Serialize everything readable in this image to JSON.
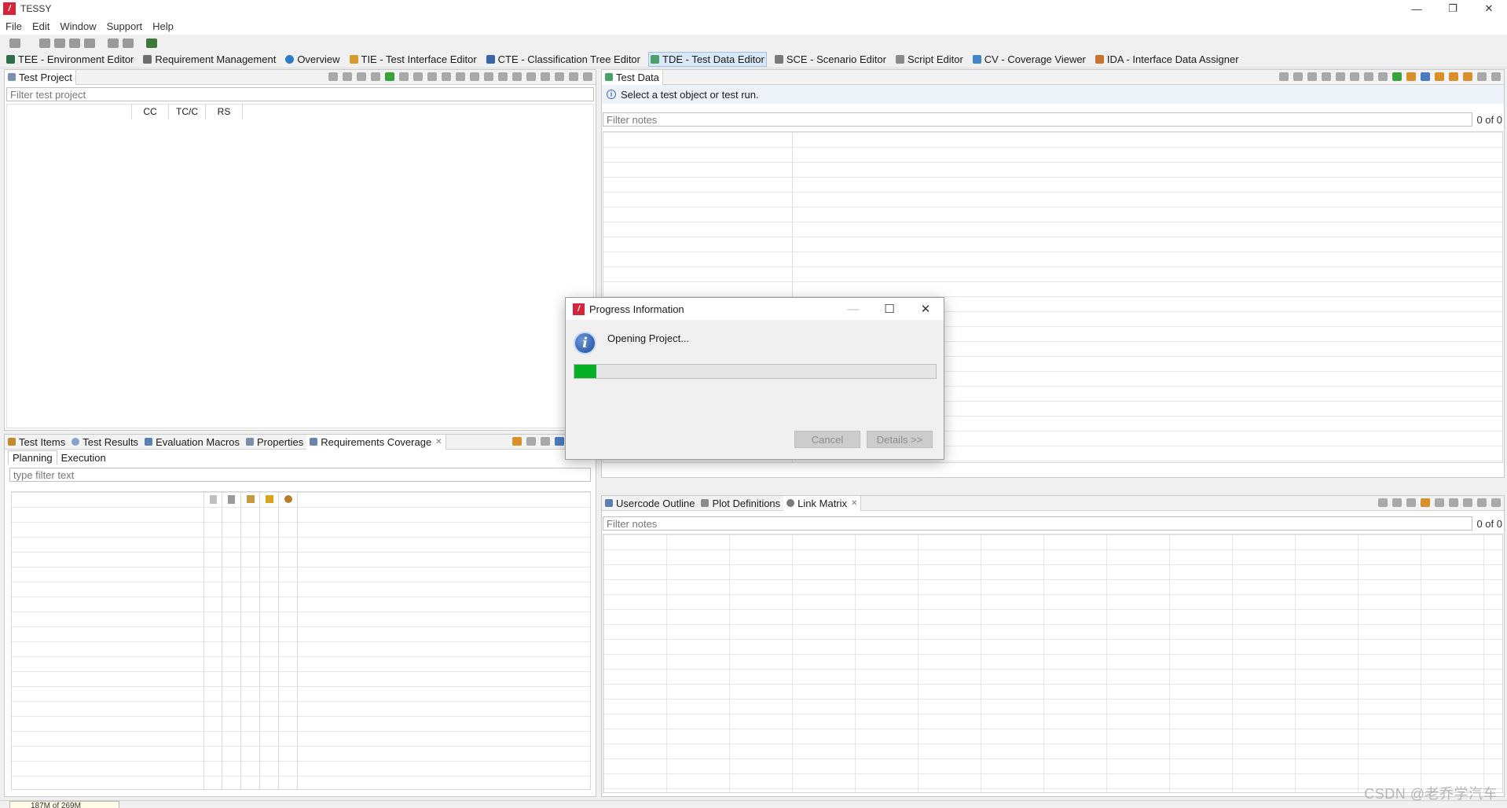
{
  "window": {
    "title": "TESSY",
    "controls": [
      "—",
      "❐",
      "✕"
    ]
  },
  "menu": [
    "File",
    "Edit",
    "Window",
    "Support",
    "Help"
  ],
  "perspectives": [
    {
      "label": "TEE - Environment Editor",
      "color": "#2f6e48",
      "active": false
    },
    {
      "label": "Requirement Management",
      "color": "#6d6d6d",
      "active": false
    },
    {
      "label": "Overview",
      "color": "#2f7ac8",
      "active": false
    },
    {
      "label": "TIE - Test Interface Editor",
      "color": "#d79a2e",
      "active": false
    },
    {
      "label": "CTE - Classification Tree Editor",
      "color": "#3a64a8",
      "active": false
    },
    {
      "label": "TDE - Test Data Editor",
      "color": "#4aa06a",
      "active": true
    },
    {
      "label": "SCE - Scenario Editor",
      "color": "#7a7a7a",
      "active": false
    },
    {
      "label": "Script Editor",
      "color": "#8a8a8a",
      "active": false
    },
    {
      "label": "CV - Coverage Viewer",
      "color": "#3f86c9",
      "active": false
    },
    {
      "label": "IDA - Interface Data Assigner",
      "color": "#c8742c",
      "active": false
    }
  ],
  "test_project": {
    "tab_label": "Test Project",
    "filter_placeholder": "Filter test project",
    "columns": [
      "CC",
      "TC/C",
      "RS"
    ]
  },
  "bottom_left": {
    "tabs": [
      {
        "label": "Test Items",
        "active": false
      },
      {
        "label": "Test Results",
        "active": false
      },
      {
        "label": "Evaluation Macros",
        "active": false
      },
      {
        "label": "Properties",
        "active": false
      },
      {
        "label": "Requirements Coverage",
        "active": true
      }
    ],
    "subtabs": [
      "Planning",
      "Execution"
    ],
    "filter_placeholder": "type filter text"
  },
  "test_data": {
    "tab_label": "Test Data",
    "info_message": "Select a test object or test run.",
    "filter_placeholder": "Filter notes",
    "count": "0 of 0"
  },
  "bottom_right": {
    "tabs": [
      {
        "label": "Usercode Outline",
        "active": false
      },
      {
        "label": "Plot Definitions",
        "active": false
      },
      {
        "label": "Link Matrix",
        "active": true
      }
    ],
    "filter_placeholder": "Filter notes",
    "count": "0 of 0"
  },
  "dialog": {
    "title": "Progress Information",
    "message": "Opening Project...",
    "progress": 0.06,
    "cancel_label": "Cancel",
    "details_label": "Details >>",
    "progress_color": "#06b025"
  },
  "status": {
    "memory": "187M of 269M"
  },
  "watermark": "CSDN @老乔学汽车"
}
